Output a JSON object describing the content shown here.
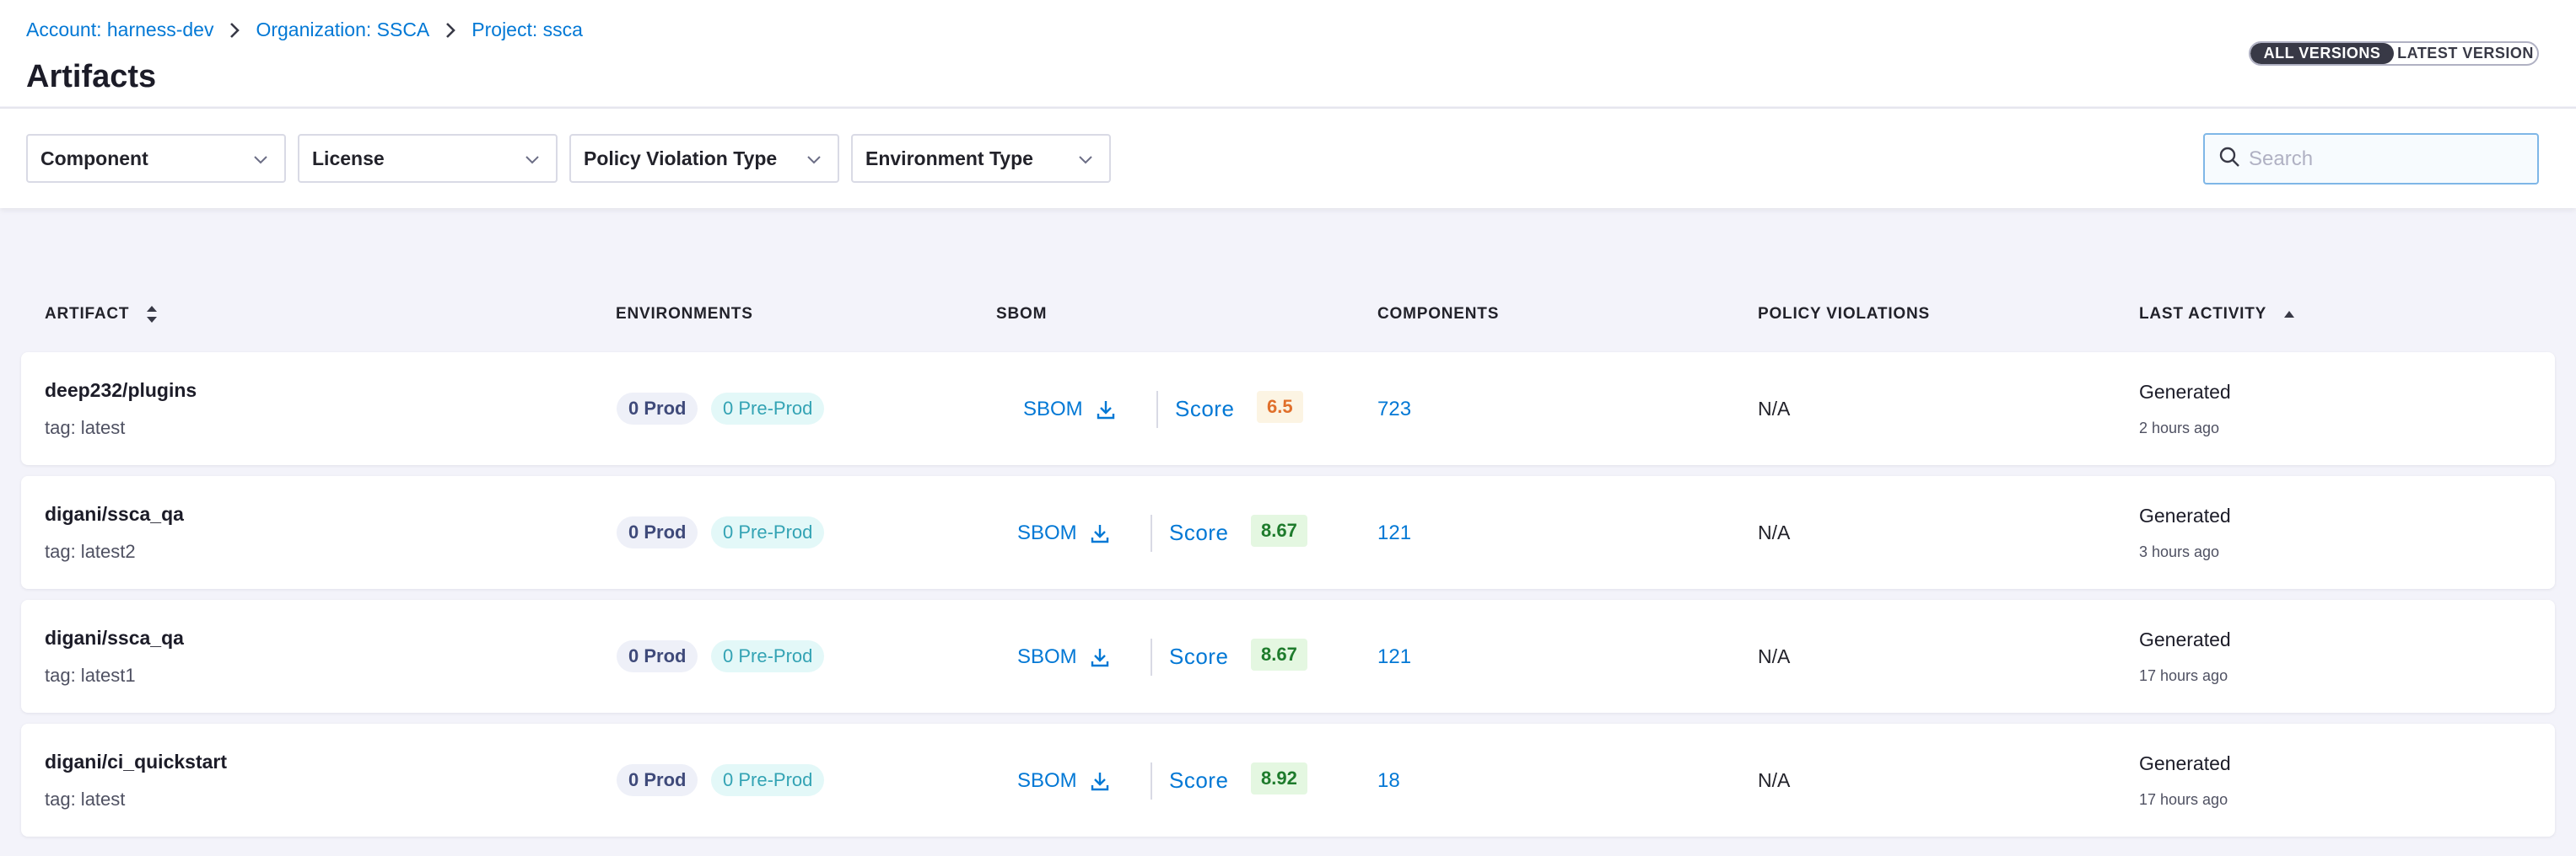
{
  "breadcrumb": [
    {
      "label": "Account: harness-dev"
    },
    {
      "label": "Organization: SSCA"
    },
    {
      "label": "Project: ssca"
    }
  ],
  "page_title": "Artifacts",
  "version_toggle": {
    "all": "ALL VERSIONS",
    "latest": "LATEST VERSION",
    "selected": "all"
  },
  "filters": [
    {
      "label": "Component"
    },
    {
      "label": "License"
    },
    {
      "label": "Policy Violation Type"
    },
    {
      "label": "Environment Type"
    }
  ],
  "search": {
    "placeholder": "Search",
    "value": ""
  },
  "table": {
    "columns": [
      "ARTIFACT",
      "ENVIRONMENTS",
      "SBOM",
      "COMPONENTS",
      "POLICY VIOLATIONS",
      "LAST ACTIVITY"
    ],
    "rows": [
      {
        "name": "deep232/plugins",
        "tag": "tag: latest",
        "prod": "0 Prod",
        "preprod": "0 Pre-Prod",
        "sbom": "SBOM",
        "score_label": "Score",
        "score": "6.5",
        "score_level": "medium",
        "components": "723",
        "violations": "N/A",
        "activity": "Generated",
        "time": "2 hours ago"
      },
      {
        "name": "digani/ssca_qa",
        "tag": "tag: latest2",
        "prod": "0 Prod",
        "preprod": "0 Pre-Prod",
        "sbom": "SBOM",
        "score_label": "Score",
        "score": "8.67",
        "score_level": "high",
        "components": "121",
        "violations": "N/A",
        "activity": "Generated",
        "time": "3 hours ago"
      },
      {
        "name": "digani/ssca_qa",
        "tag": "tag: latest1",
        "prod": "0 Prod",
        "preprod": "0 Pre-Prod",
        "sbom": "SBOM",
        "score_label": "Score",
        "score": "8.67",
        "score_level": "high",
        "components": "121",
        "violations": "N/A",
        "activity": "Generated",
        "time": "17 hours ago"
      },
      {
        "name": "digani/ci_quickstart",
        "tag": "tag: latest",
        "prod": "0 Prod",
        "preprod": "0 Pre-Prod",
        "sbom": "SBOM",
        "score_label": "Score",
        "score": "8.92",
        "score_level": "high",
        "components": "18",
        "violations": "N/A",
        "activity": "Generated",
        "time": "17 hours ago"
      }
    ]
  },
  "colors": {
    "link": "#0278d5",
    "score_medium_bg": "#fcf4e3",
    "score_medium_fg": "#e06f2b",
    "score_high_bg": "#e4f7e1",
    "score_high_fg": "#1e7b2c"
  }
}
